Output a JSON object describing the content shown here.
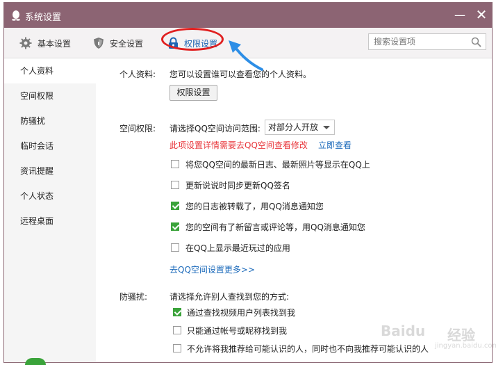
{
  "window": {
    "title": "系统设置",
    "minimize": "—",
    "close": "✕"
  },
  "toolbar": {
    "tabs": [
      {
        "label": "基本设置",
        "icon": "gear-icon"
      },
      {
        "label": "安全设置",
        "icon": "shield-icon"
      },
      {
        "label": "权限设置",
        "icon": "lock-icon",
        "active": true
      }
    ],
    "search_placeholder": "搜索设置项"
  },
  "sidebar": {
    "items": [
      {
        "label": "个人资料",
        "active": true
      },
      {
        "label": "空间权限"
      },
      {
        "label": "防骚扰"
      },
      {
        "label": "临时会话"
      },
      {
        "label": "资讯提醒"
      },
      {
        "label": "个人状态"
      },
      {
        "label": "远程桌面"
      }
    ]
  },
  "profile": {
    "label": "个人资料:",
    "description": "您可以设置谁可以查看您的个人资料。",
    "button": "权限设置"
  },
  "space": {
    "label": "空间权限:",
    "range_label": "请选择QQ空间访问范围:",
    "range_value": "对部分人开放",
    "warning": "此项设置详情需要去QQ空间查看修改",
    "view_link": "立即查看",
    "options": [
      {
        "label": "将您QQ空间的最新日志、最新照片等显示在QQ上",
        "checked": false
      },
      {
        "label": "更新说说时同步更新QQ签名",
        "checked": false
      },
      {
        "label": "您的日志被转载了，用QQ消息通知您",
        "checked": true
      },
      {
        "label": "您的空间有了新留言或评论等，用QQ消息通知您",
        "checked": true
      },
      {
        "label": "在QQ上显示最近玩过的应用",
        "checked": false
      }
    ],
    "more_link": "去QQ空间设置更多>>"
  },
  "harass": {
    "label": "防骚扰:",
    "prompt": "请选择允许别人查找到您的方式:",
    "options": [
      {
        "label": "通过查找视频用户列表找到我",
        "checked": true
      },
      {
        "label": "只能通过帐号或昵称找到我",
        "checked": false
      },
      {
        "label": "不允许将我推荐给可能认识的人，同时也不向我推荐可能认识的人",
        "checked": false
      }
    ]
  },
  "watermark": {
    "brand": "Bai",
    "logo_char": "du",
    "suffix": "经验",
    "url": "jingyan.baidu.com"
  },
  "colors": {
    "titlebar": "#8c6473",
    "accent": "#1d64b3",
    "warning": "#e8353a",
    "check": "#3aa33a",
    "annotation_red": "#e02020",
    "annotation_blue": "#2d8ee6"
  }
}
